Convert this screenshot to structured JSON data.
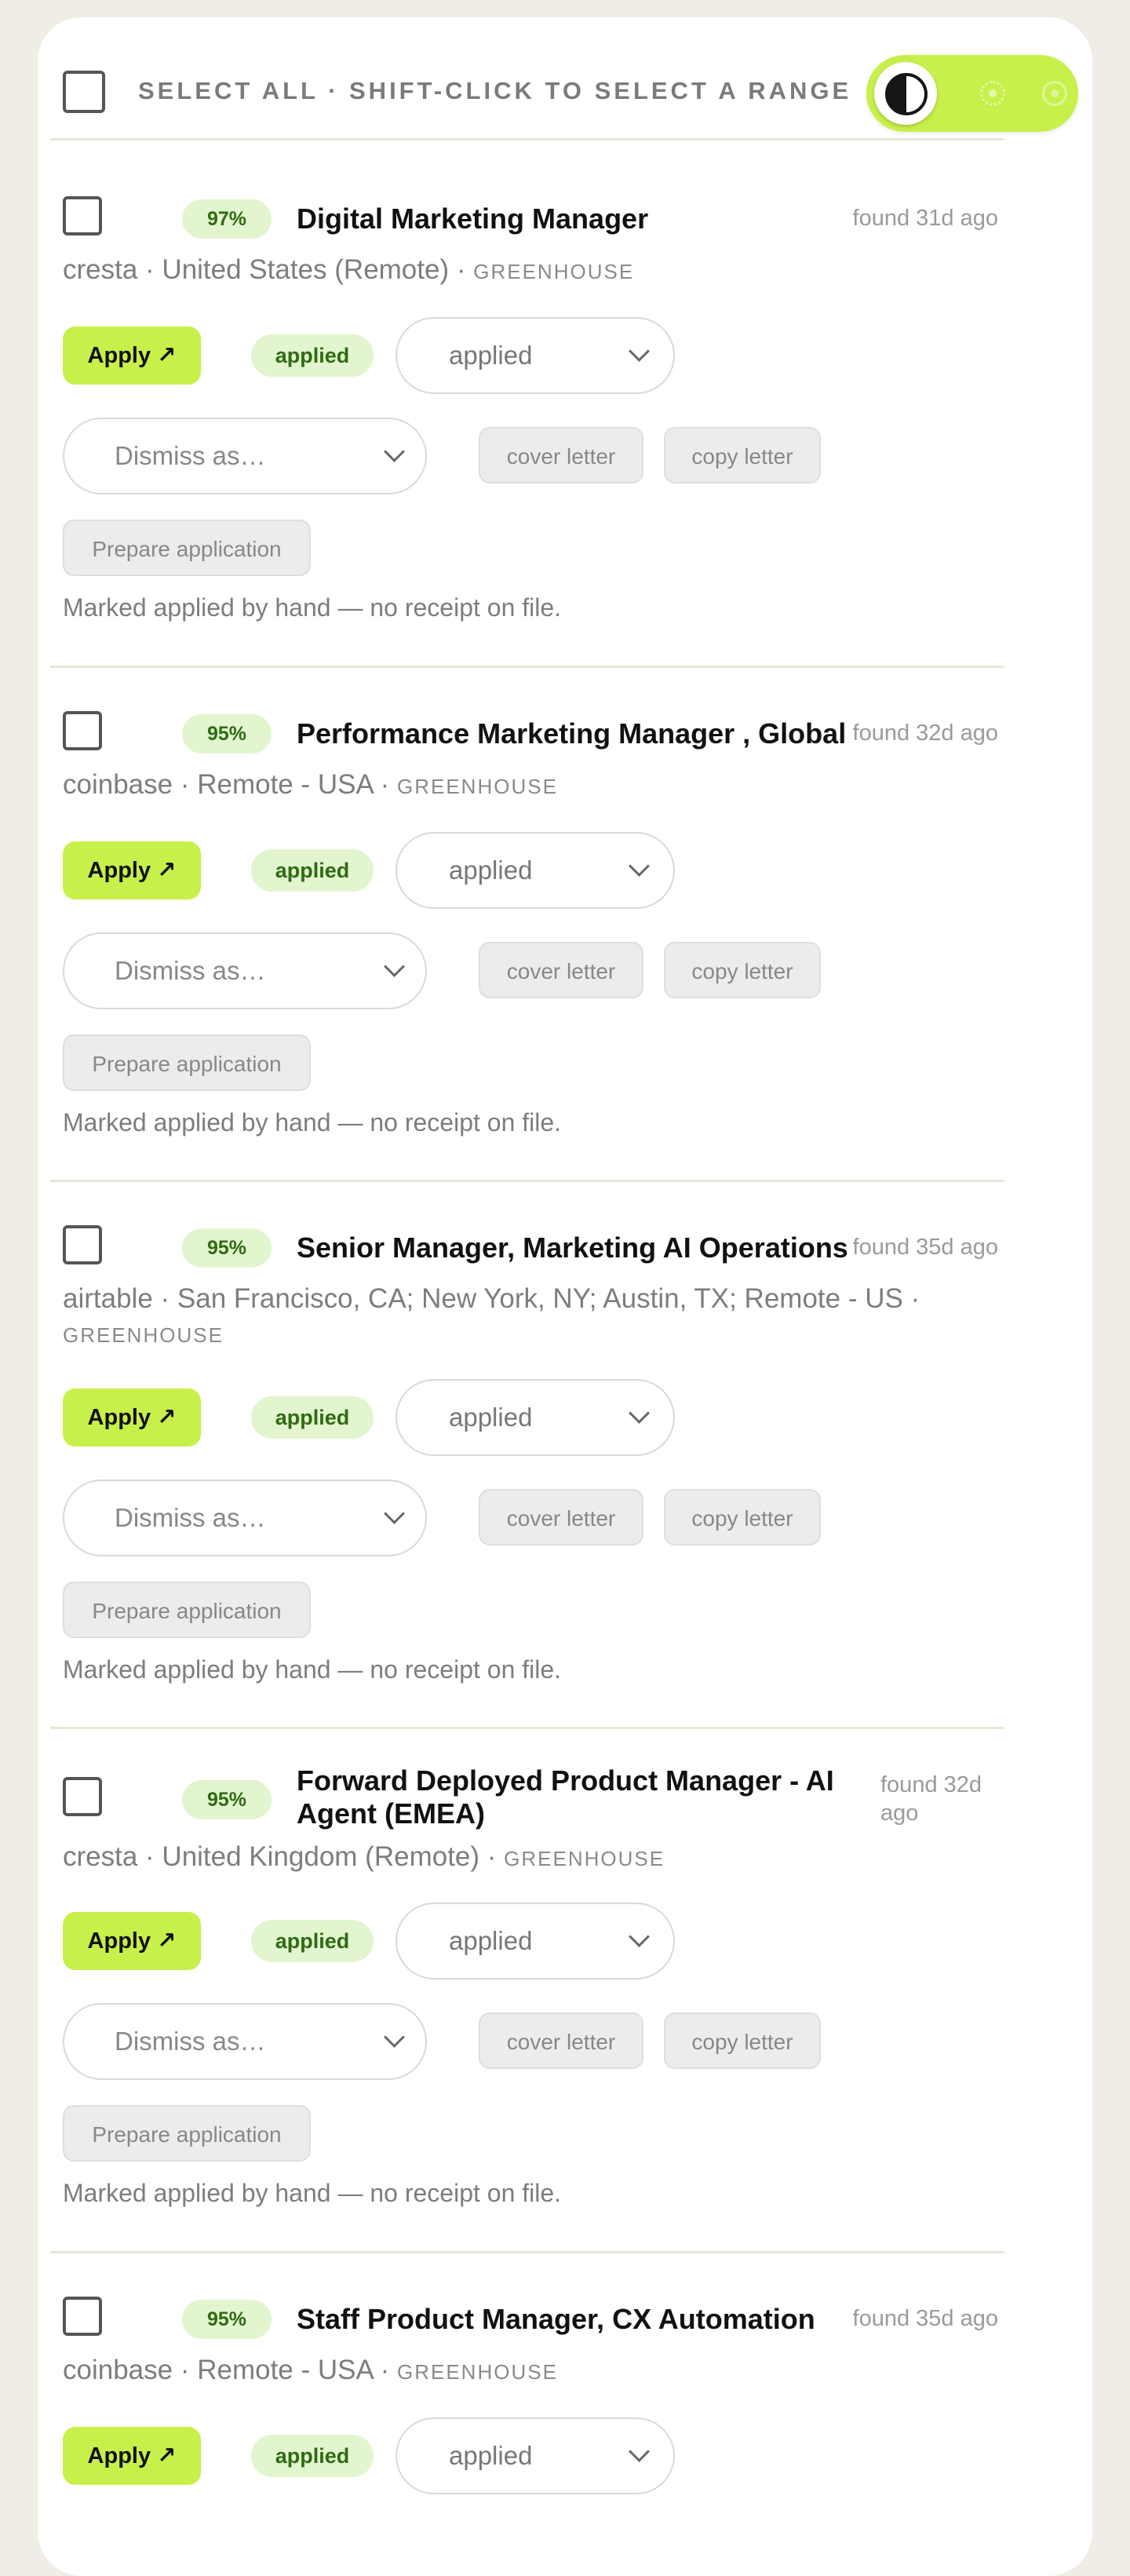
{
  "toolbar": {
    "select_all_label": "SELECT ALL · SHIFT-CLICK TO SELECT A RANGE",
    "theme_icons": [
      "contrast-icon",
      "sun-icon",
      "moon-icon"
    ]
  },
  "colors": {
    "accent": "#c8f04a",
    "badge_bg": "#e2f5cf",
    "badge_text": "#2f6b12",
    "page_bg": "#efede6"
  },
  "actions": {
    "apply_label": "Apply ↗",
    "applied_badge": "applied",
    "status_value": "applied",
    "dismiss_placeholder": "Dismiss as…",
    "cover_letter_label": "cover letter",
    "copy_letter_label": "copy letter",
    "prepare_label": "Prepare application",
    "note": "Marked applied by hand — no receipt on file."
  },
  "jobs": [
    {
      "score": "97%",
      "title": "Digital Marketing Manager",
      "found": "found 31d ago",
      "meta": "cresta · United States (Remote) · ",
      "source": "GREENHOUSE"
    },
    {
      "score": "95%",
      "title": "Performance Marketing Manager , Global",
      "found": "found 32d ago",
      "meta": "coinbase · Remote - USA · ",
      "source": "GREENHOUSE"
    },
    {
      "score": "95%",
      "title": "Senior Manager, Marketing AI Operations",
      "found": "found 35d ago",
      "meta": "airtable · San Francisco, CA; New York, NY; Austin, TX; Remote - US · ",
      "source": "GREENHOUSE"
    },
    {
      "score": "95%",
      "title": "Forward Deployed Product Manager - AI Agent (EMEA)",
      "found": "found 32d ago",
      "meta": "cresta · United Kingdom (Remote) · ",
      "source": "GREENHOUSE"
    },
    {
      "score": "95%",
      "title": "Staff Product Manager, CX Automation",
      "found": "found 35d ago",
      "meta": "coinbase · Remote - USA · ",
      "source": "GREENHOUSE"
    }
  ]
}
